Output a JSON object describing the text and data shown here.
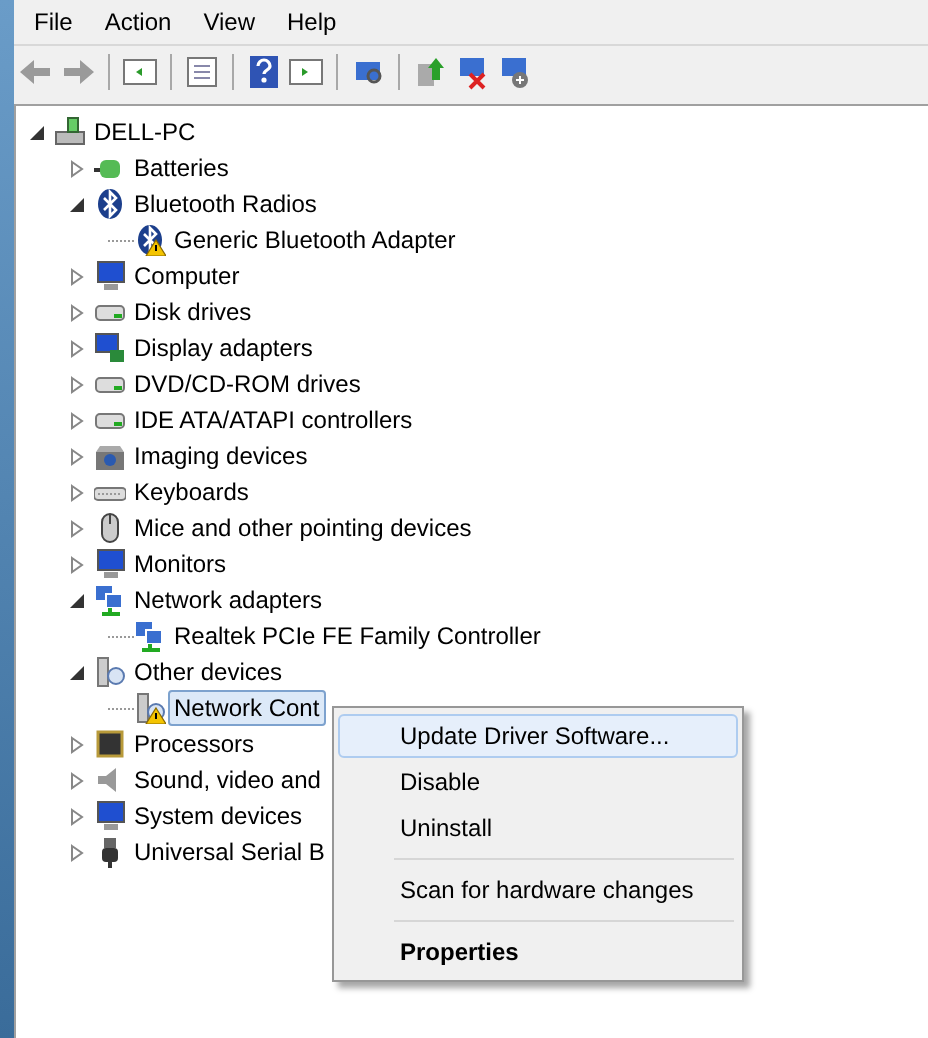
{
  "menu_bar": [
    {
      "label": "File"
    },
    {
      "label": "Action"
    },
    {
      "label": "View"
    },
    {
      "label": "Help"
    }
  ],
  "tree": {
    "label": "DELL-PC",
    "kind": "pc",
    "expanded": true,
    "children": [
      {
        "label": "Batteries",
        "kind": "battery",
        "expanded": false,
        "selected": false
      },
      {
        "label": "Bluetooth Radios",
        "kind": "bluetooth",
        "expanded": true,
        "selected": false,
        "children": [
          {
            "label": "Generic Bluetooth Adapter",
            "kind": "bluetooth",
            "warning": true,
            "selected": false
          }
        ]
      },
      {
        "label": "Computer",
        "kind": "computer",
        "expanded": false,
        "selected": false
      },
      {
        "label": "Disk drives",
        "kind": "disk",
        "expanded": false,
        "selected": false
      },
      {
        "label": "Display adapters",
        "kind": "display",
        "expanded": false,
        "selected": false
      },
      {
        "label": "DVD/CD-ROM drives",
        "kind": "disk",
        "expanded": false,
        "selected": false
      },
      {
        "label": "IDE ATA/ATAPI controllers",
        "kind": "disk",
        "expanded": false,
        "selected": false
      },
      {
        "label": "Imaging devices",
        "kind": "camera",
        "expanded": false,
        "selected": false
      },
      {
        "label": "Keyboards",
        "kind": "keyboard",
        "expanded": false,
        "selected": false
      },
      {
        "label": "Mice and other pointing devices",
        "kind": "mouse",
        "expanded": false,
        "selected": false
      },
      {
        "label": "Monitors",
        "kind": "computer",
        "expanded": false,
        "selected": false
      },
      {
        "label": "Network adapters",
        "kind": "network",
        "expanded": true,
        "selected": false,
        "children": [
          {
            "label": "Realtek PCIe FE Family Controller",
            "kind": "network",
            "warning": false,
            "selected": false
          }
        ]
      },
      {
        "label": "Other devices",
        "kind": "other",
        "expanded": true,
        "selected": false,
        "children": [
          {
            "label": "Network Cont",
            "kind": "other",
            "warning": true,
            "selected": true
          }
        ]
      },
      {
        "label": "Processors",
        "kind": "chip",
        "expanded": false,
        "selected": false
      },
      {
        "label": "Sound, video and",
        "kind": "speaker",
        "expanded": false,
        "selected": false
      },
      {
        "label": "System devices",
        "kind": "computer",
        "expanded": false,
        "selected": false
      },
      {
        "label": "Universal Serial B",
        "kind": "usb",
        "expanded": false,
        "selected": false
      }
    ]
  },
  "context_menu": {
    "groups": [
      [
        {
          "label": "Update Driver Software...",
          "selected": true,
          "default": false
        },
        {
          "label": "Disable",
          "selected": false,
          "default": false
        },
        {
          "label": "Uninstall",
          "selected": false,
          "default": false
        }
      ],
      [
        {
          "label": "Scan for hardware changes",
          "selected": false,
          "default": false
        }
      ],
      [
        {
          "label": "Properties",
          "selected": false,
          "default": true
        }
      ]
    ]
  }
}
